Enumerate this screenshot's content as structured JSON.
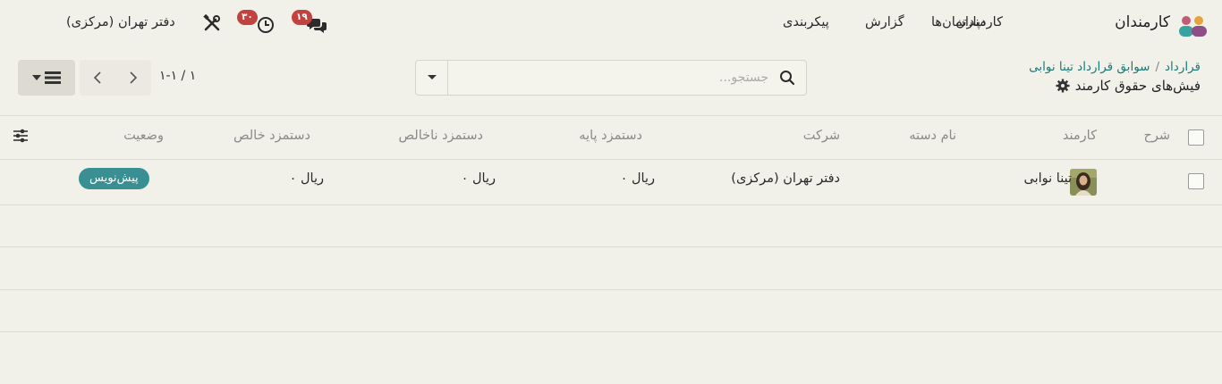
{
  "app": {
    "name": "کارمندان"
  },
  "nav": [
    "کارمندان",
    "دپارتمان‌ها",
    "گزارش",
    "پیکربندی"
  ],
  "systray": {
    "company": "دفتر تهران (مرکزی)",
    "activity_count": "۳۰",
    "messages_count": "۱۹"
  },
  "breadcrumb": {
    "root": "قرارداد",
    "separator": "/",
    "parent": "سوابق قرارداد تینا نوابی"
  },
  "page_title": "فیش‌های حقوق کارمند",
  "search": {
    "placeholder": "جستجو..."
  },
  "pager": {
    "range": "۱-۱ / ۱"
  },
  "table": {
    "headers": {
      "description": "شرح",
      "employee": "کارمند",
      "batch": "نام دسته",
      "company": "شرکت",
      "basic": "دستمزد پایه",
      "gross": "دستمزد ناخالص",
      "net": "دستمزد خالص",
      "status": "وضعیت"
    },
    "rows": [
      {
        "employee": "تینا نوابی",
        "company": "دفتر تهران (مرکزی)",
        "basic": "ریال ۰",
        "gross": "ریال ۰",
        "net": "ریال ۰",
        "status": "پیش‌نویس"
      }
    ]
  },
  "colors": {
    "accent": "#1a7a77",
    "badge": "#c2423f",
    "status_draft": "#3a8f93",
    "background": "#f1f0e9"
  }
}
